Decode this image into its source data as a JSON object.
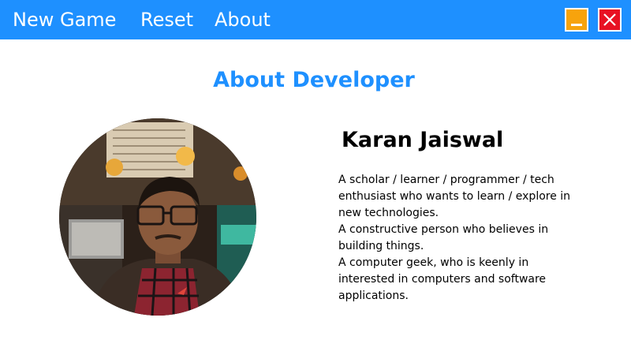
{
  "menu": {
    "new_game": "New Game",
    "reset": "Reset",
    "about": "About"
  },
  "window_controls": {
    "minimize_icon": "minimize-icon",
    "close_icon": "close-icon",
    "minimize_color": "#f7a30c",
    "close_color": "#e81123"
  },
  "colors": {
    "accent": "#1e90ff"
  },
  "page": {
    "title": "About Developer"
  },
  "developer": {
    "name": "Karan Jaiswal",
    "photo": "developer-photo",
    "bio": [
      "A scholar / learner / programmer / tech enthusiast who wants to learn / explore in new technologies.",
      "A constructive person who believes in building things.",
      "A computer geek, who is keenly in interested in computers and software applications."
    ]
  }
}
